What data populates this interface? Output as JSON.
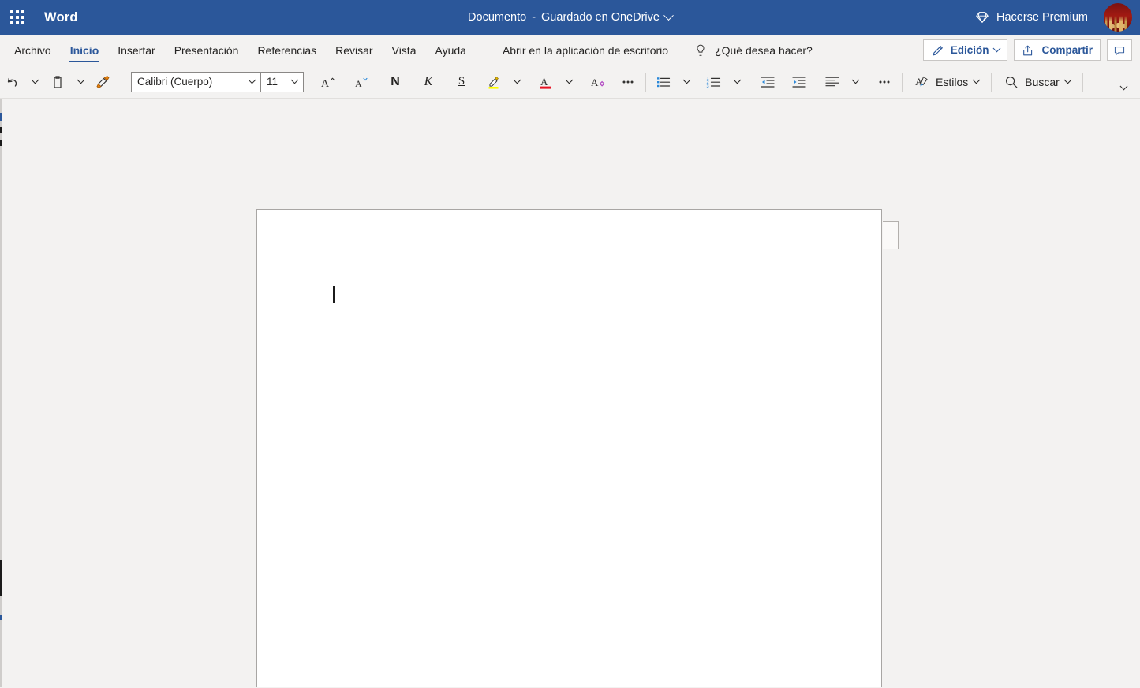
{
  "titlebar": {
    "app_launcher_icon": "waffle-grid-icon",
    "app_name": "Word",
    "doc_name": "Documento",
    "doc_separator": "-",
    "save_status": "Guardado en OneDrive",
    "doc_title_chevron_icon": "chevron-down-icon",
    "premium_icon": "diamond-icon",
    "premium_label": "Hacerse Premium",
    "avatar_name": "user-avatar",
    "brand_color": "#2b579a",
    "text_color": "#ffffff"
  },
  "tabs": [
    {
      "label": "Archivo",
      "active": false
    },
    {
      "label": "Inicio",
      "active": true
    },
    {
      "label": "Insertar",
      "active": false
    },
    {
      "label": "Presentación",
      "active": false
    },
    {
      "label": "Referencias",
      "active": false
    },
    {
      "label": "Revisar",
      "active": false
    },
    {
      "label": "Vista",
      "active": false
    },
    {
      "label": "Ayuda",
      "active": false
    }
  ],
  "tabbar": {
    "open_desktop_label": "Abrir en la aplicación de escritorio",
    "tell_me_icon": "lightbulb-icon",
    "tell_me_label": "¿Qué desea hacer?",
    "editing_icon": "pencil-icon",
    "editing_label": "Edición",
    "editing_chevron_icon": "chevron-down-icon",
    "share_icon": "share-icon",
    "share_label": "Compartir",
    "comments_icon": "comment-icon",
    "accent_color": "#2b579a"
  },
  "ribbon": {
    "undo": {
      "icon": "undo-icon",
      "name": "Deshacer"
    },
    "undo_more_icon": "chevron-down-icon",
    "paste": {
      "icon": "clipboard-icon",
      "name": "Pegar"
    },
    "paste_more_icon": "chevron-down-icon",
    "format_painter": {
      "icon": "format-painter-icon",
      "name": "Copiar formato"
    },
    "font_name": "Calibri (Cuerpo)",
    "font_name_chevron": "chevron-down-icon",
    "font_size": "11",
    "font_size_chevron": "chevron-down-icon",
    "grow_font": {
      "icon": "grow-font-icon",
      "glyph": "A"
    },
    "shrink_font": {
      "icon": "shrink-font-icon",
      "glyph": "A"
    },
    "bold": {
      "icon": "bold-icon",
      "glyph": "N"
    },
    "italic": {
      "icon": "italic-icon",
      "glyph": "K"
    },
    "underline": {
      "icon": "underline-icon",
      "glyph": "S"
    },
    "highlight": {
      "icon": "highlight-icon",
      "color": "#ffff00"
    },
    "highlight_chevron": "chevron-down-icon",
    "font_color": {
      "icon": "font-color-icon",
      "color": "#e81123",
      "glyph": "A"
    },
    "font_color_chevron": "chevron-down-icon",
    "clear_formatting": {
      "icon": "clear-formatting-icon",
      "glyph": "A"
    },
    "font_more_icon": "ellipsis-icon",
    "bullets": {
      "icon": "bullets-icon"
    },
    "bullets_chevron": "chevron-down-icon",
    "numbering": {
      "icon": "numbering-icon"
    },
    "numbering_chevron": "chevron-down-icon",
    "decrease_indent": {
      "icon": "decrease-indent-icon"
    },
    "increase_indent": {
      "icon": "increase-indent-icon"
    },
    "align": {
      "icon": "align-left-icon"
    },
    "align_chevron": "chevron-down-icon",
    "paragraph_more_icon": "ellipsis-icon",
    "styles": {
      "icon": "styles-icon",
      "label": "Estilos",
      "chevron": "chevron-down-icon"
    },
    "find": {
      "icon": "search-icon",
      "label": "Buscar",
      "chevron": "chevron-down-icon"
    },
    "collapse_icon": "chevron-down-icon"
  },
  "canvas": {
    "page_background": "#ffffff",
    "surface_background": "#f3f2f1",
    "caret_visible": true,
    "comments_handle_name": "comments-pane-handle",
    "document_text": ""
  }
}
